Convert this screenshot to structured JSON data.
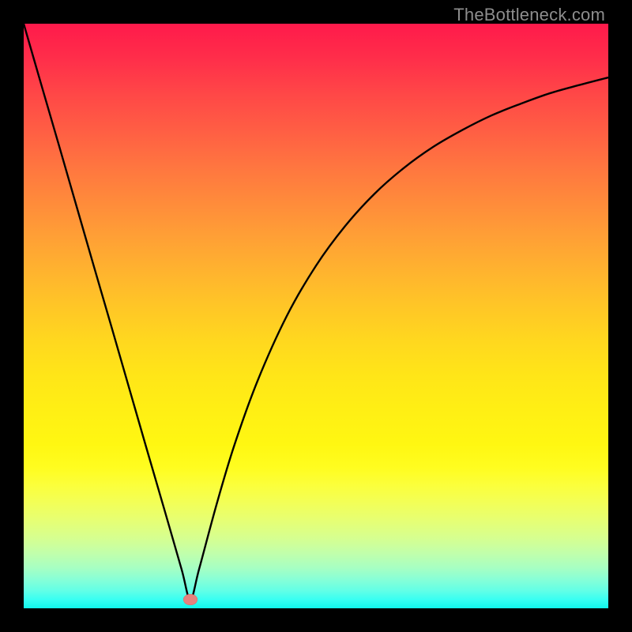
{
  "watermark": "TheBottleneck.com",
  "colors": {
    "curve_stroke": "#000000",
    "marker_fill": "#e6827e",
    "frame_bg": "#000000"
  },
  "chart_data": {
    "type": "line",
    "title": "",
    "xlabel": "",
    "ylabel": "",
    "xlim": [
      0,
      1
    ],
    "ylim": [
      0,
      1
    ],
    "background": "heatmap-gradient-red-to-green",
    "minimum": {
      "x": 0.285,
      "y": 0.015
    },
    "series": [
      {
        "name": "bottleneck-curve",
        "x": [
          0.0,
          0.03,
          0.06,
          0.09,
          0.12,
          0.15,
          0.18,
          0.21,
          0.24,
          0.27,
          0.285,
          0.3,
          0.33,
          0.36,
          0.4,
          0.45,
          0.5,
          0.55,
          0.6,
          0.65,
          0.7,
          0.75,
          0.8,
          0.85,
          0.9,
          0.95,
          1.0
        ],
        "y": [
          1.0,
          0.896,
          0.793,
          0.689,
          0.585,
          0.482,
          0.378,
          0.274,
          0.171,
          0.067,
          0.015,
          0.067,
          0.178,
          0.278,
          0.389,
          0.5,
          0.586,
          0.654,
          0.709,
          0.753,
          0.789,
          0.818,
          0.843,
          0.863,
          0.881,
          0.895,
          0.908
        ],
        "values": [
          1.0,
          0.896,
          0.793,
          0.689,
          0.585,
          0.482,
          0.378,
          0.274,
          0.171,
          0.067,
          0.015,
          0.067,
          0.178,
          0.278,
          0.389,
          0.5,
          0.586,
          0.654,
          0.709,
          0.753,
          0.789,
          0.818,
          0.843,
          0.863,
          0.881,
          0.895,
          0.908
        ]
      }
    ]
  }
}
